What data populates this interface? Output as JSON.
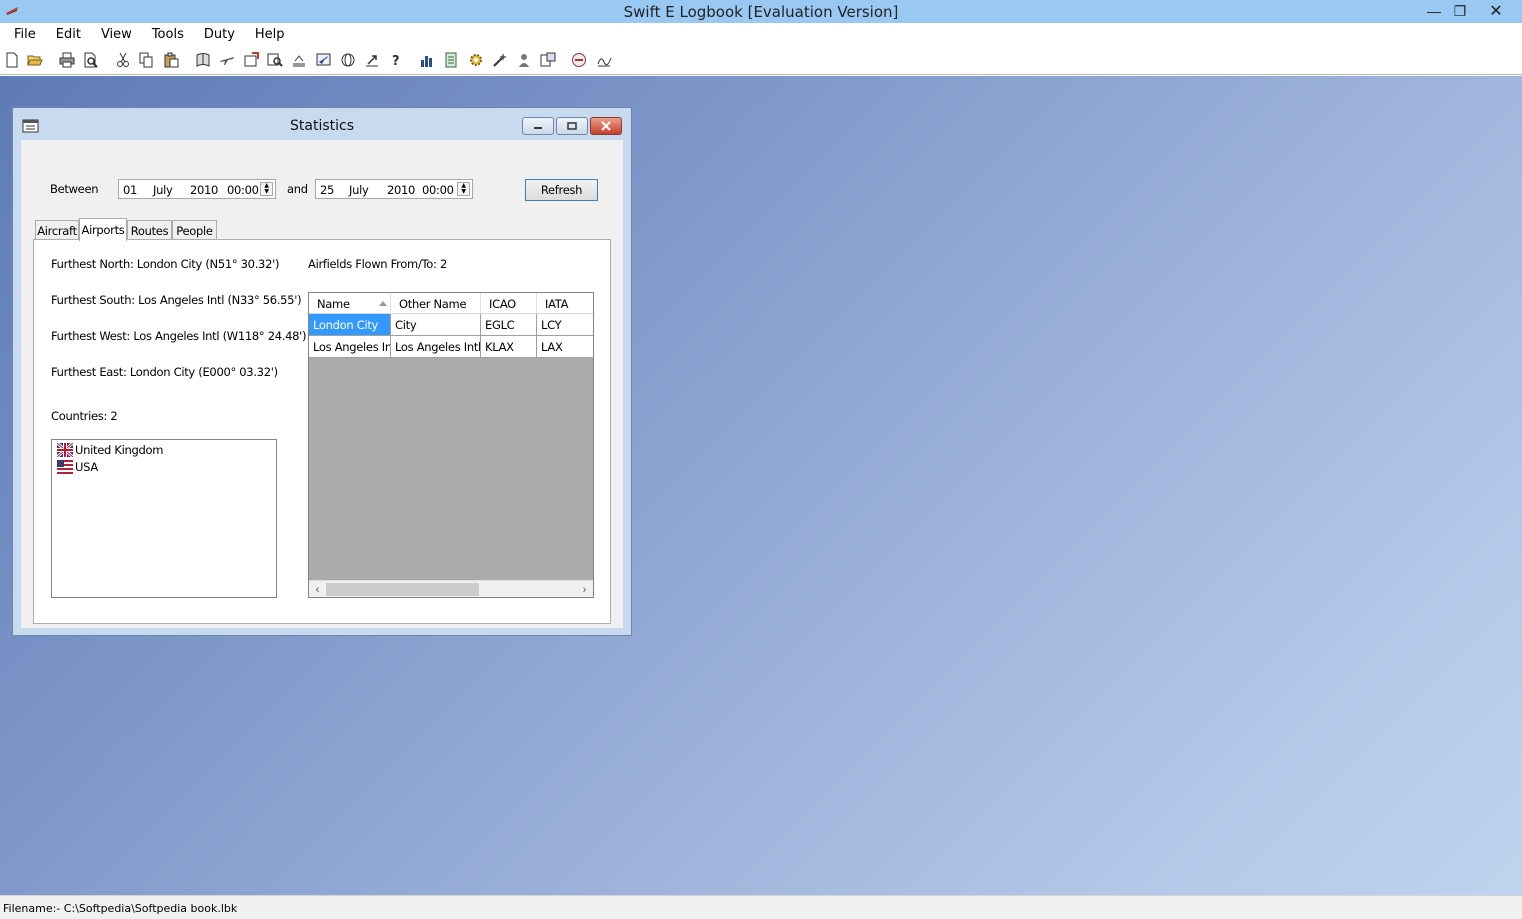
{
  "app": {
    "title": "Swift E Logbook [Evaluation Version]",
    "window_controls": {
      "minimize": "—",
      "restore": "❐",
      "close": "✕"
    }
  },
  "menu": [
    "File",
    "Edit",
    "View",
    "Tools",
    "Duty",
    "Help"
  ],
  "toolbar": {
    "buttons": [
      "new-icon",
      "open-icon",
      "print-icon",
      "print-preview-icon",
      "cut-icon",
      "copy-icon",
      "paste-icon",
      "logbook-icon",
      "aircraft-icon",
      "add-entry-icon",
      "search-icon",
      "align-icon",
      "plane-icon",
      "globe-icon",
      "export-icon",
      "help-icon",
      "chart-icon",
      "report-icon",
      "settings-icon",
      "wizard-icon",
      "user-icon",
      "totals-icon",
      "duty-icon",
      "signature-icon"
    ]
  },
  "statistics": {
    "title": "Statistics",
    "between_label": "Between",
    "and_label": "and",
    "from": {
      "day": "01",
      "month": "July",
      "year": "2010",
      "time": "00:00"
    },
    "to": {
      "day": "25",
      "month": "July",
      "year": "2010",
      "time": "00:00"
    },
    "refresh_label": "Refresh",
    "tabs": [
      "Aircraft",
      "Airports",
      "Routes",
      "People"
    ],
    "active_tab": "Airports",
    "airports": {
      "furthest_north": "Furthest North: London City  (N51° 30.32')",
      "furthest_south": "Furthest South: Los Angeles Intl  (N33° 56.55')",
      "furthest_west": "Furthest West: Los Angeles Intl  (W118° 24.48')",
      "furthest_east": "Furthest East: London City  (E000° 03.32')",
      "countries_label": "Countries: 2",
      "countries": [
        {
          "name": "United Kingdom",
          "flag": "uk-flag-icon"
        },
        {
          "name": "USA",
          "flag": "usa-flag-icon"
        }
      ],
      "airfields_label": "Airfields Flown From/To: 2",
      "columns": [
        "Name",
        "Other Name",
        "ICAO",
        "IATA"
      ],
      "rows": [
        [
          "London City",
          "City",
          "EGLC",
          "LCY"
        ],
        [
          "Los Angeles Intl",
          "Los Angeles Intl",
          "KLAX",
          "LAX"
        ]
      ],
      "selected_row": 0
    }
  },
  "status": {
    "filename": "Filename:- C:\\Softpedia\\Softpedia book.lbk"
  },
  "colors": {
    "titlebar": "#99c9f2",
    "selection": "#3399ff",
    "desktop": "#7b95c8"
  }
}
